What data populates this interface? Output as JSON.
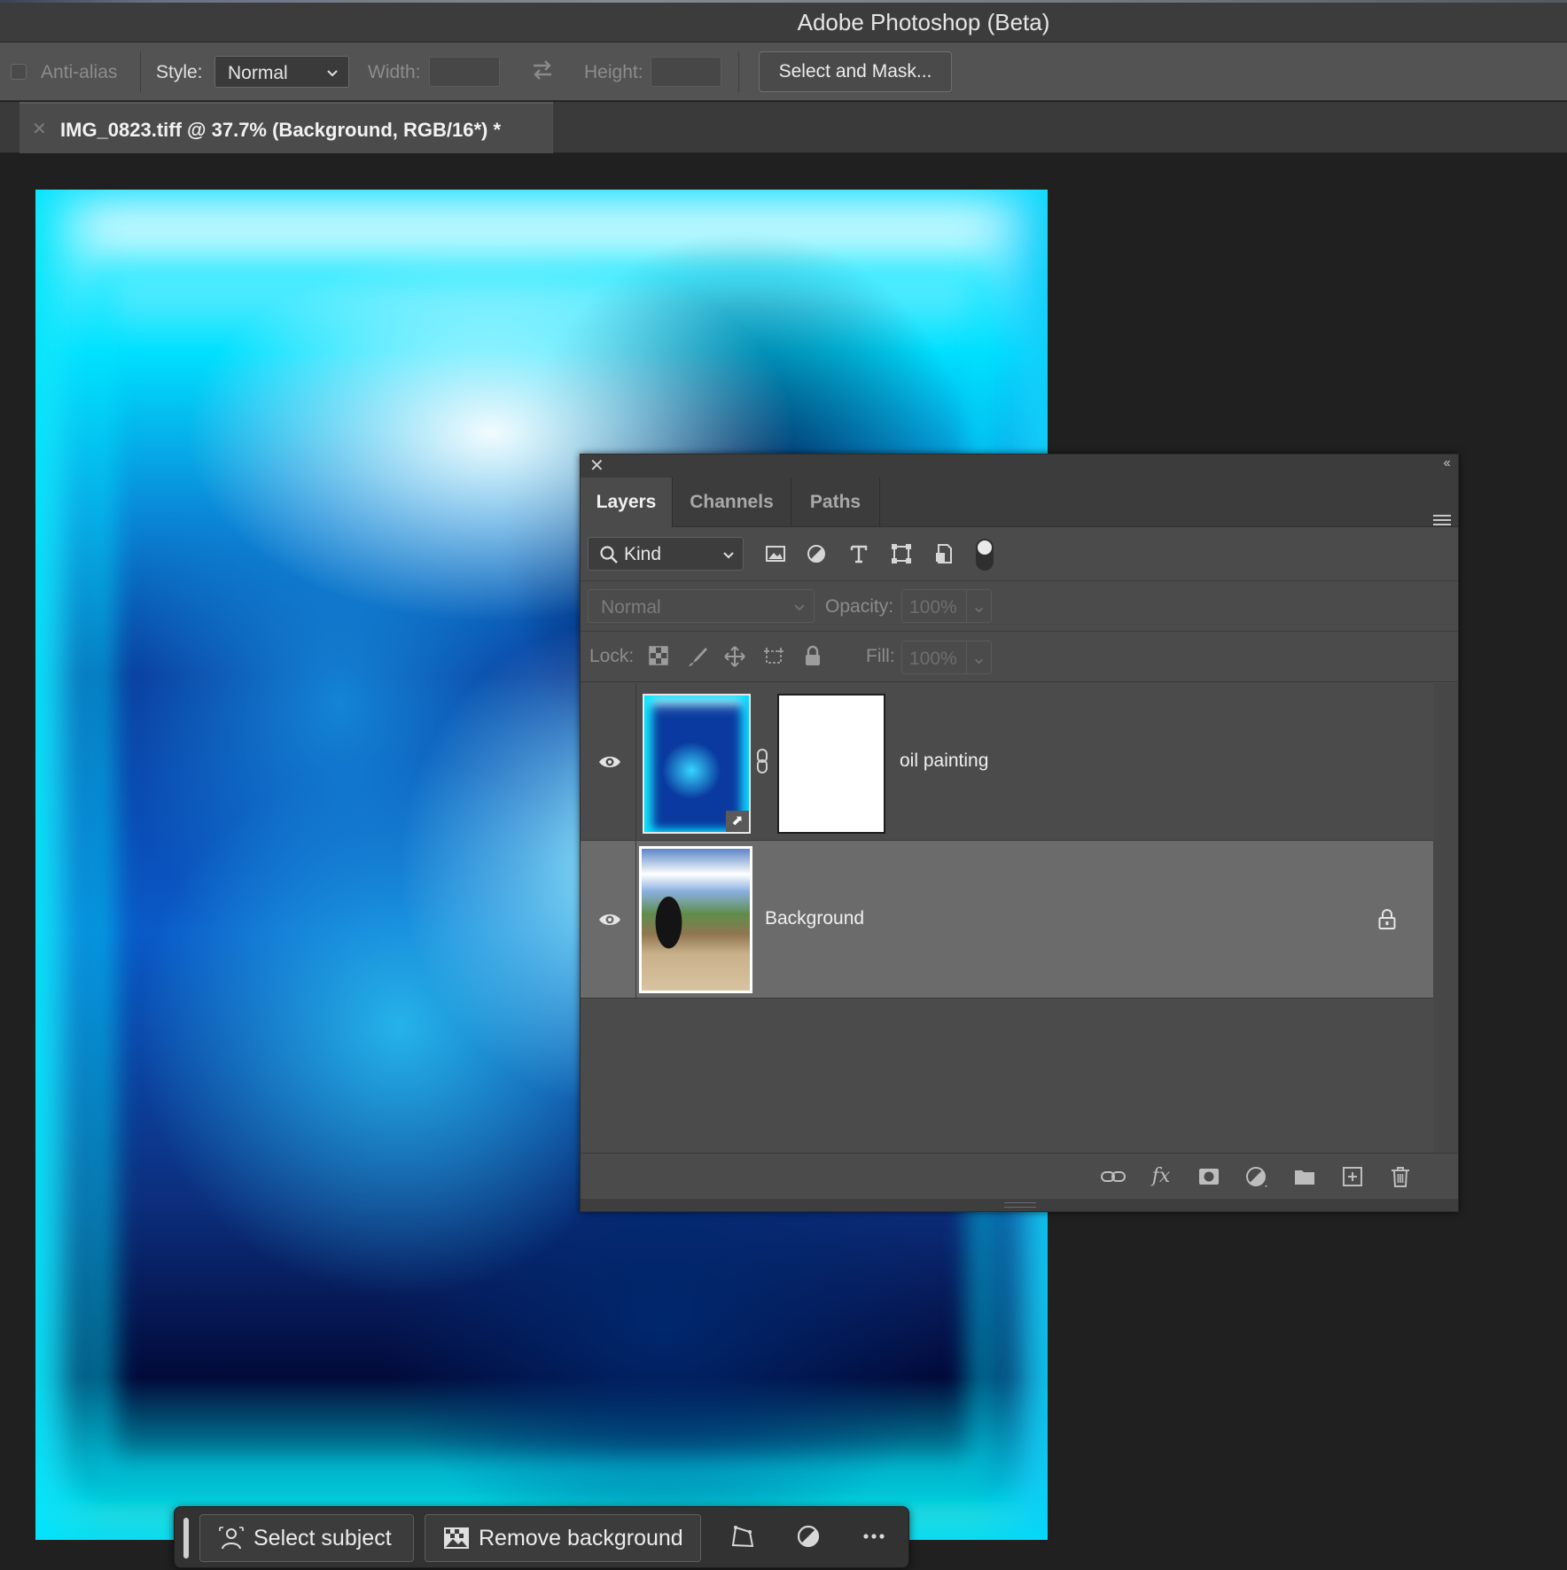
{
  "app": {
    "title": "Adobe Photoshop (Beta)"
  },
  "options_bar": {
    "anti_alias_label": "Anti-alias",
    "style_label": "Style:",
    "style_value": "Normal",
    "width_label": "Width:",
    "width_value": "",
    "height_label": "Height:",
    "height_value": "",
    "select_and_mask_label": "Select and Mask..."
  },
  "document": {
    "tab_title": "IMG_0823.tiff @ 37.7% (Background, RGB/16*) *",
    "zoom_percent": 37.7
  },
  "layers_panel": {
    "tabs": [
      {
        "label": "Layers",
        "active": true
      },
      {
        "label": "Channels",
        "active": false
      },
      {
        "label": "Paths",
        "active": false
      }
    ],
    "filter_kind": "Kind",
    "blend_mode": "Normal",
    "opacity_label": "Opacity:",
    "opacity_value": "100%",
    "lock_label": "Lock:",
    "fill_label": "Fill:",
    "fill_value": "100%",
    "layers": [
      {
        "name": "oil painting",
        "visible": true,
        "smart_object": true,
        "has_mask": true,
        "selected": false,
        "locked": false
      },
      {
        "name": "Background",
        "visible": true,
        "smart_object": false,
        "has_mask": false,
        "selected": true,
        "locked": true
      }
    ],
    "footer_icons": [
      "link-layers-icon",
      "fx-icon",
      "add-mask-icon",
      "adjustment-layer-icon",
      "new-group-icon",
      "new-layer-icon",
      "delete-layer-icon"
    ]
  },
  "taskbar": {
    "select_subject_label": "Select subject",
    "remove_background_label": "Remove background"
  },
  "colors": {
    "panel_bg": "#4b4b4b",
    "selected_layer_bg": "#6b6b6b",
    "canvas_bg": "#202020"
  }
}
